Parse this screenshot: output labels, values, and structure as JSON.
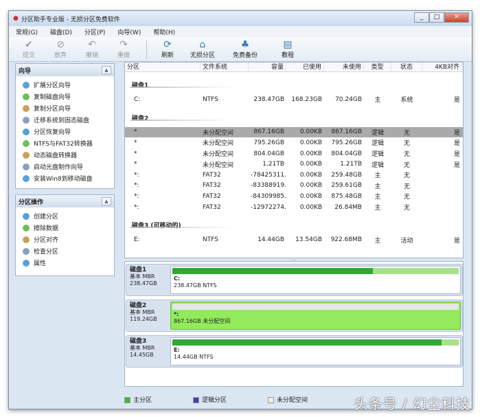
{
  "window": {
    "title": "分区助手专业版 - 无损分区免费软件"
  },
  "menu": [
    "常规(G)",
    "磁盘(D)",
    "分区(P)",
    "向导(W)",
    "帮助(H)"
  ],
  "toolbar": [
    {
      "label": "提交",
      "icon": "check-icon",
      "enabled": false
    },
    {
      "label": "放弃",
      "icon": "discard-icon",
      "enabled": false
    },
    {
      "label": "撤销",
      "icon": "undo-icon",
      "enabled": false
    },
    {
      "label": "重做",
      "icon": "redo-icon",
      "enabled": false
    },
    {
      "label": "刷新",
      "icon": "refresh-icon",
      "enabled": true
    },
    {
      "label": "无损分区",
      "icon": "partition-icon",
      "enabled": true
    },
    {
      "label": "免费备份",
      "icon": "backup-icon",
      "enabled": true
    },
    {
      "label": "教程",
      "icon": "tutorial-icon",
      "enabled": true
    }
  ],
  "wizard": {
    "title": "向导",
    "items": [
      "扩展分区向导",
      "复制磁盘向导",
      "复制分区向导",
      "迁移系统到固态磁盘",
      "分区恢复向导",
      "NTFS与FAT32转换器",
      "动态磁盘转换器",
      "启动光盘制作向导",
      "安装Win8到移动磁盘"
    ]
  },
  "ops": {
    "title": "分区操作",
    "items": [
      "创建分区",
      "擦除数据",
      "分区对齐",
      "检查分区",
      "属性"
    ]
  },
  "columns": [
    "分区",
    "文件系统",
    "容量",
    "已使用",
    "未使用",
    "类型",
    "状态",
    "4KB对齐"
  ],
  "groups": [
    {
      "name": "磁盘1",
      "rows": [
        [
          "C:",
          "NTFS",
          "238.47GB",
          "168.23GB",
          "70.24GB",
          "主",
          "系统",
          "是"
        ]
      ]
    },
    {
      "name": "磁盘2",
      "rows": [
        [
          "*",
          "未分配空间",
          "867.16GB",
          "0.00KB",
          "867.16GB",
          "逻辑",
          "无",
          "是"
        ],
        [
          "*",
          "未分配空间",
          "795.26GB",
          "0.00KB",
          "795.26GB",
          "逻辑",
          "无",
          "是"
        ],
        [
          "*",
          "未分配空间",
          "804.04GB",
          "0.00KB",
          "804.04GB",
          "逻辑",
          "无",
          "是"
        ],
        [
          "*",
          "未分配空间",
          "1.21TB",
          "0.00KB",
          "1.21TB",
          "逻辑",
          "无",
          "是"
        ],
        [
          "*:",
          "FAT32",
          "-78425311...",
          "0.00KB",
          "259.48GB",
          "主",
          "无",
          ""
        ],
        [
          "*:",
          "FAT32",
          "-83388919...",
          "0.00KB",
          "259.61GB",
          "主",
          "无",
          ""
        ],
        [
          "*:",
          "FAT32",
          "-84309985...",
          "0.00KB",
          "875.48GB",
          "主",
          "无",
          ""
        ],
        [
          "*:",
          "FAT32",
          "-12972274...",
          "0.00KB",
          "26.84MB",
          "主",
          "无",
          ""
        ]
      ]
    },
    {
      "name": "磁盘3 (可移动的)",
      "rows": [
        [
          "E:",
          "NTFS",
          "14.44GB",
          "13.54GB",
          "922.68MB",
          "主",
          "活动",
          "是"
        ]
      ]
    }
  ],
  "disks": [
    {
      "name": "磁盘1",
      "type": "基本 MBR",
      "size": "238.47GB",
      "part": "C:",
      "desc": "238.47GB NTFS",
      "used_pct": 70,
      "unalloc": false
    },
    {
      "name": "磁盘2",
      "type": "基本 MBR",
      "size": "119.24GB",
      "part": "*:",
      "desc": "867.16GB 未分配空间",
      "used_pct": 0,
      "unalloc": true
    },
    {
      "name": "磁盘3",
      "type": "基本 MBR",
      "size": "14.45GB",
      "part": "E:",
      "desc": "14.44GB NTFS",
      "used_pct": 94,
      "unalloc": false
    }
  ],
  "legend": [
    {
      "label": "主分区",
      "color": "#3cb83c"
    },
    {
      "label": "逻辑分区",
      "color": "#4040b8"
    },
    {
      "label": "未分配空间",
      "color": "#f0ece4"
    }
  ],
  "watermark": "头条号 / 幻尘科技"
}
